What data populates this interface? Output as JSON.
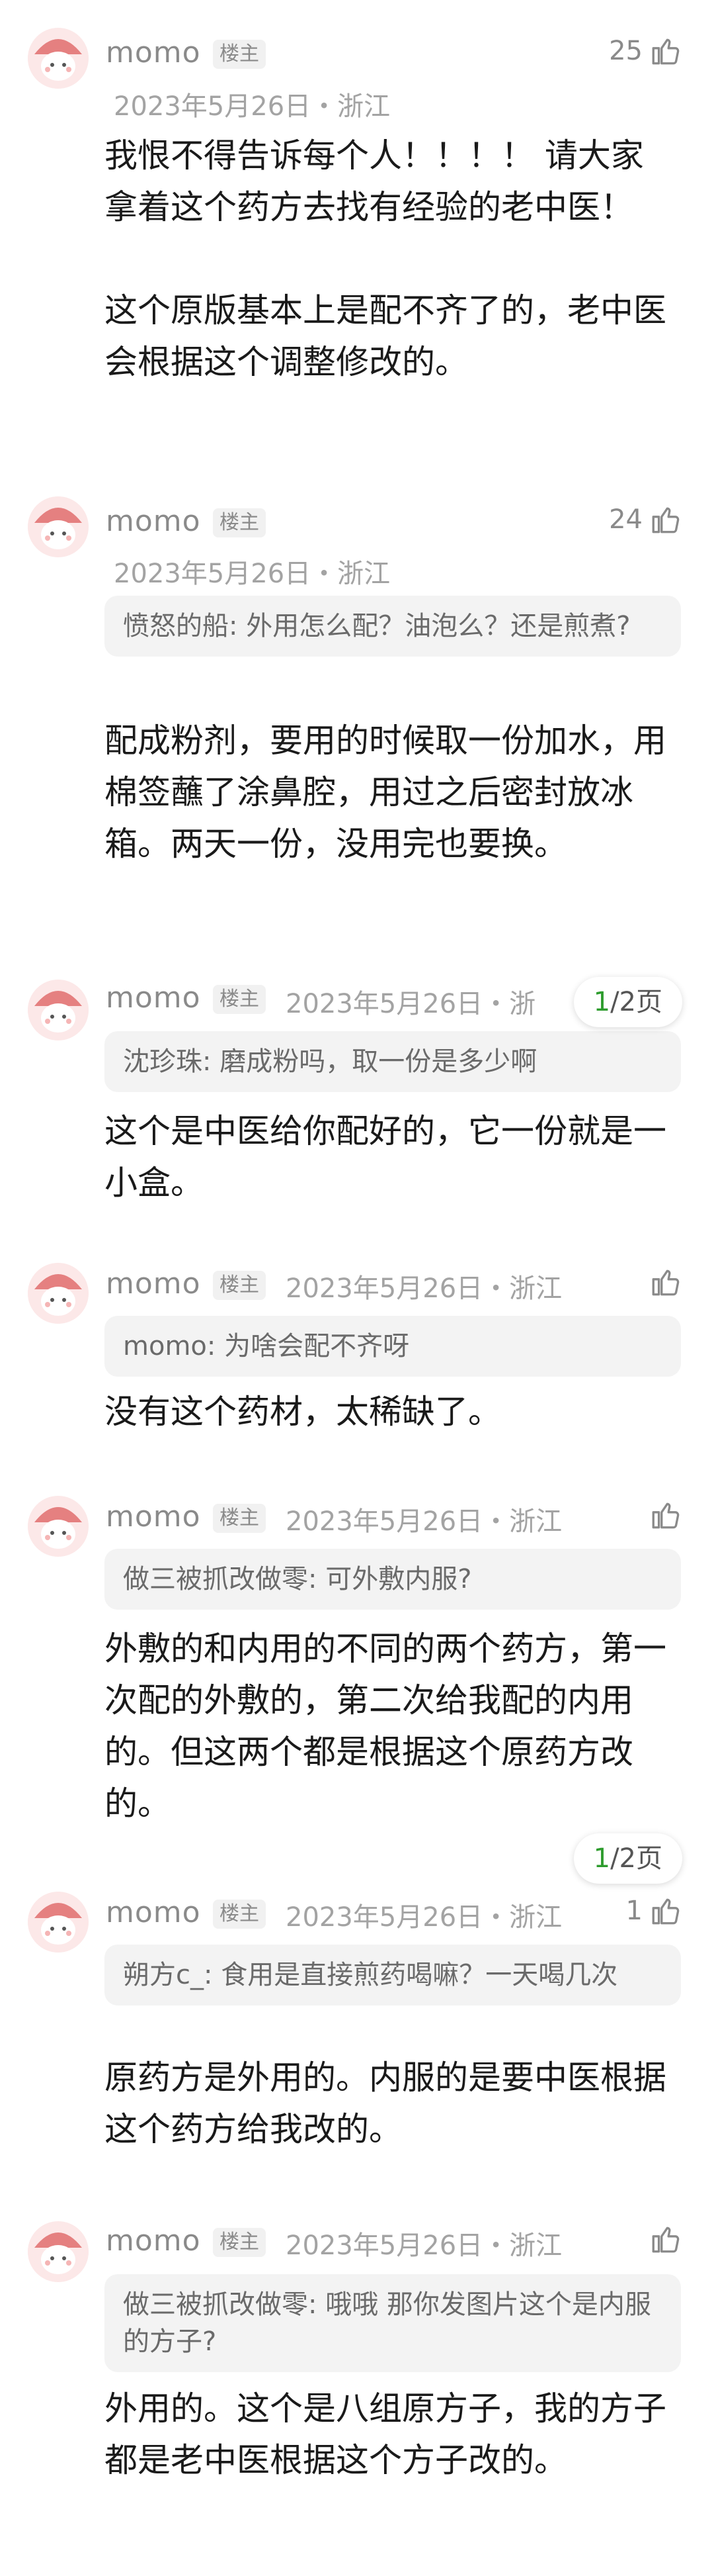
{
  "comments": [
    {
      "name": "momo",
      "badge": "楼主",
      "date": "2023年5月26日・浙江",
      "likes": "25",
      "quote_user": "",
      "quote_text": "",
      "body": "我恨不得告诉每个人！！！！ 请大家拿着这个药方去找有经验的老中医！\n\n这个原版基本上是配不齐了的，老中医会根据这个调整修改的。"
    },
    {
      "name": "momo",
      "badge": "楼主",
      "date": "2023年5月26日・浙江",
      "likes": "24",
      "quote_user": "愤怒的船",
      "quote_text": "外用怎么配？油泡么？还是煎煮?",
      "body": "配成粉剂，要用的时候取一份加水，用棉签蘸了涂鼻腔，用过之后密封放冰箱。两天一份，没用完也要换。"
    },
    {
      "name": "momo",
      "badge": "楼主",
      "date": "2023年5月26日・浙",
      "likes": "",
      "quote_user": "沈珍珠",
      "quote_text": "磨成粉吗，取一份是多少啊",
      "body": "这个是中医给你配好的，它一份就是一小盒。"
    },
    {
      "name": "momo",
      "badge": "楼主",
      "date": "2023年5月26日・浙江",
      "likes": "",
      "quote_user": "momo",
      "quote_text": "为啥会配不齐呀",
      "body": "没有这个药材，太稀缺了。"
    },
    {
      "name": "momo",
      "badge": "楼主",
      "date": "2023年5月26日・浙江",
      "likes": "",
      "quote_user": "做三被抓改做零",
      "quote_text": "可外敷内服?",
      "body": "外敷的和内用的不同的两个药方，第一次配的外敷的，第二次给我配的内用的。但这两个都是根据这个原药方改的。"
    },
    {
      "name": "momo",
      "badge": "楼主",
      "date": "2023年5月26日・浙江",
      "likes": "1",
      "quote_user": "朔方c_",
      "quote_text": "食用是直接煎药喝嘛？一天喝几次",
      "body": "原药方是外用的。内服的是要中医根据这个药方给我改的。"
    },
    {
      "name": "momo",
      "badge": "楼主",
      "date": "2023年5月26日・浙江",
      "likes": "",
      "quote_user": "做三被抓改做零",
      "quote_text": "哦哦 那你发图片这个是内服的方子?",
      "body": "外用的。这个是八组原方子，我的方子都是老中医根据这个方子改的。"
    }
  ],
  "pager1": {
    "current": "1",
    "rest": "/2页"
  },
  "pager2": {
    "current": "1",
    "rest": "/2页"
  }
}
